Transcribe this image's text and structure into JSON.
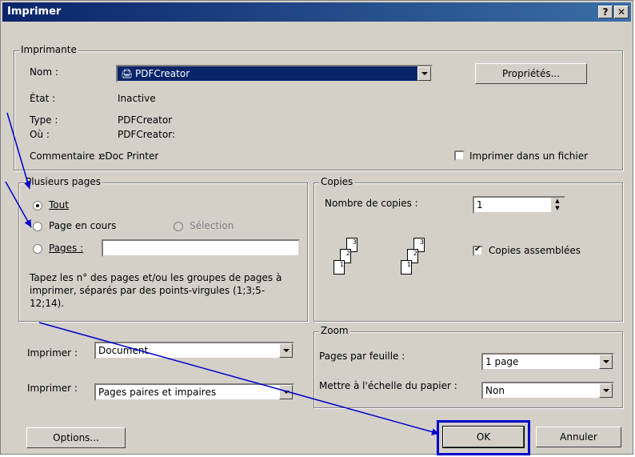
{
  "title": "Imprimer",
  "title_buttons": {
    "help": "?",
    "close": "✕"
  },
  "printer": {
    "legend": "Imprimante",
    "name_label": "Nom :",
    "name_value": "PDFCreator",
    "properties_button": "Propriétés...",
    "state_label": "État :",
    "state_value": "Inactive",
    "type_label": "Type :",
    "type_value": "PDFCreator",
    "where_label": "Où :",
    "where_value": "PDFCreator:",
    "comment_label": "Commentaire :",
    "comment_value": "eDoc Printer",
    "print_to_file": "Imprimer dans un fichier",
    "print_to_file_checked": false
  },
  "pages": {
    "legend": "Plusieurs pages",
    "all": "Tout",
    "current": "Page en cours",
    "selection": "Sélection",
    "pages": "Pages :",
    "pages_value": "",
    "selected": "all",
    "hint": "Tapez les n° des pages et/ou les groupes de pages à imprimer, séparés par des points-virgules (1;3;5-12;14)."
  },
  "copies": {
    "legend": "Copies",
    "count_label": "Nombre de copies :",
    "count_value": "1",
    "collate": "Copies assemblées",
    "collate_checked": true,
    "page_numbers": [
      "3",
      "2",
      "1"
    ]
  },
  "print_what": {
    "label": "Imprimer :",
    "value": "Document"
  },
  "print_range": {
    "label": "Imprimer :",
    "value": "Pages paires et impaires"
  },
  "zoom": {
    "legend": "Zoom",
    "pages_per_sheet_label": "Pages par feuille :",
    "pages_per_sheet_value": "1 page",
    "scale_label": "Mettre à l'échelle du papier :",
    "scale_value": "Non"
  },
  "buttons": {
    "options": "Options...",
    "ok": "OK",
    "cancel": "Annuler"
  },
  "colors": {
    "title_start": "#0a246a",
    "title_end": "#3a6ea5",
    "annotation": "#0000cc",
    "face": "#d4d0c8"
  }
}
